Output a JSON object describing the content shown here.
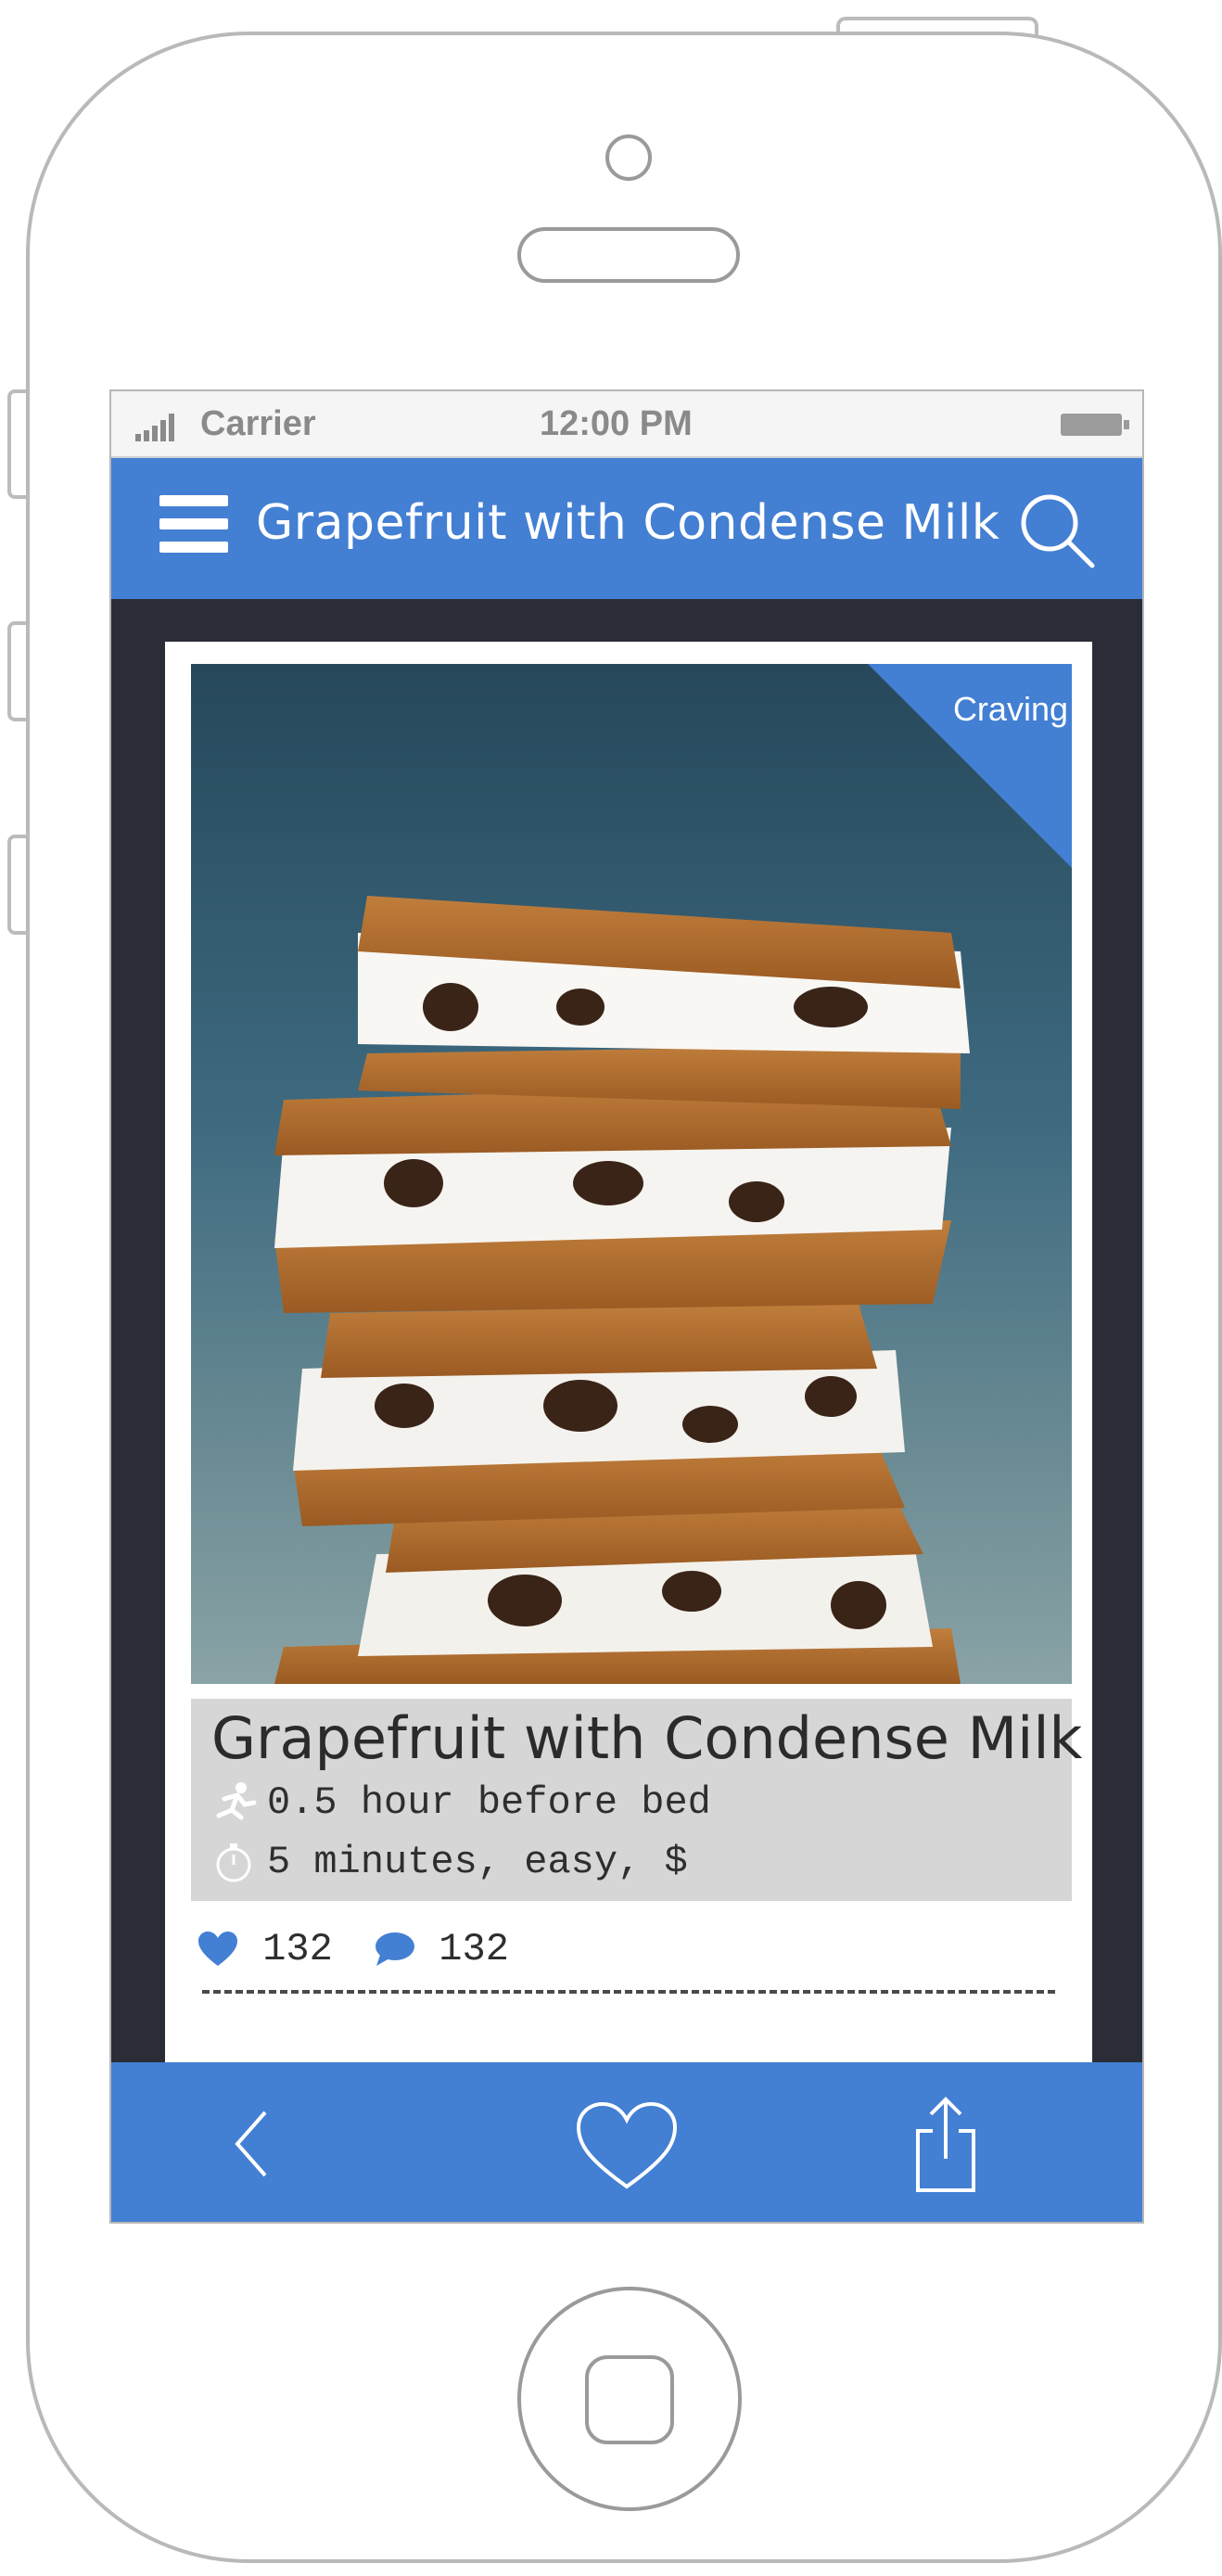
{
  "statusbar": {
    "carrier": "Carrier",
    "time": "12:00 PM"
  },
  "navbar": {
    "title": "Grapefruit with Condense Milk"
  },
  "card": {
    "badge": "Craving",
    "title": "Grapefruit with Condense Milk",
    "timing": "0.5 hour before bed",
    "details": "5 minutes, easy, $",
    "likes": "132",
    "comments": "132"
  },
  "icons": [
    "menu-icon",
    "search-icon",
    "running-icon",
    "stopwatch-icon",
    "heart-icon",
    "comment-icon",
    "back-icon",
    "favorite-icon",
    "share-icon"
  ],
  "colors": {
    "accent": "#437fd3",
    "screen_bg": "#2a2d38",
    "info_bg": "#d6d6d6"
  }
}
